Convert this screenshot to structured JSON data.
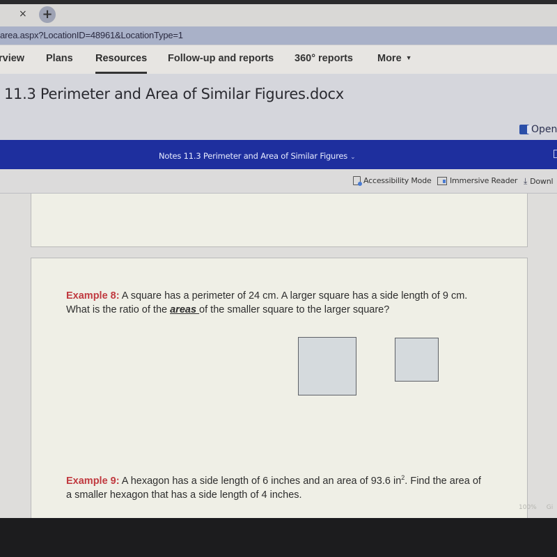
{
  "browser": {
    "tab_close_glyph": "×",
    "new_tab_glyph": "+",
    "address": "area.aspx?LocationID=48961&LocationType=1"
  },
  "nav": {
    "items": [
      {
        "label": "rview",
        "active": false
      },
      {
        "label": "Plans",
        "active": false
      },
      {
        "label": "Resources",
        "active": true
      },
      {
        "label": "Follow-up and reports",
        "active": false
      },
      {
        "label": "360° reports",
        "active": false
      },
      {
        "label": "More",
        "active": false
      }
    ],
    "more_caret": "▼"
  },
  "document": {
    "title": "11.3 Perimeter and Area of Similar Figures.docx",
    "open_label": "Open",
    "viewer_name": "Notes 11.3 Perimeter and Area of Similar Figures",
    "viewer_chevron": "⌄"
  },
  "toolbar": {
    "accessibility_mode": "Accessibility Mode",
    "immersive_reader": "Immersive Reader",
    "download": "Downl",
    "download_icon": "⤓"
  },
  "content": {
    "example8": {
      "label": "Example 8:",
      "line1": " A square has a perimeter of 24 cm.  A larger square has a side length of 9 cm.",
      "line2_pre": "What is the ratio of the ",
      "line2_em": "areas ",
      "line2_post": "of the smaller square to the larger square?"
    },
    "example9": {
      "label": "Example 9:",
      "line1_pre": " A hexagon has a side length of 6 inches and an area of 93.6 in",
      "line1_sup": "2",
      "line1_post": ".  Find the area of",
      "line2": "a smaller hexagon that has a side length of 4 inches."
    }
  },
  "status": {
    "zoom": "100%",
    "extra": "Gi"
  }
}
